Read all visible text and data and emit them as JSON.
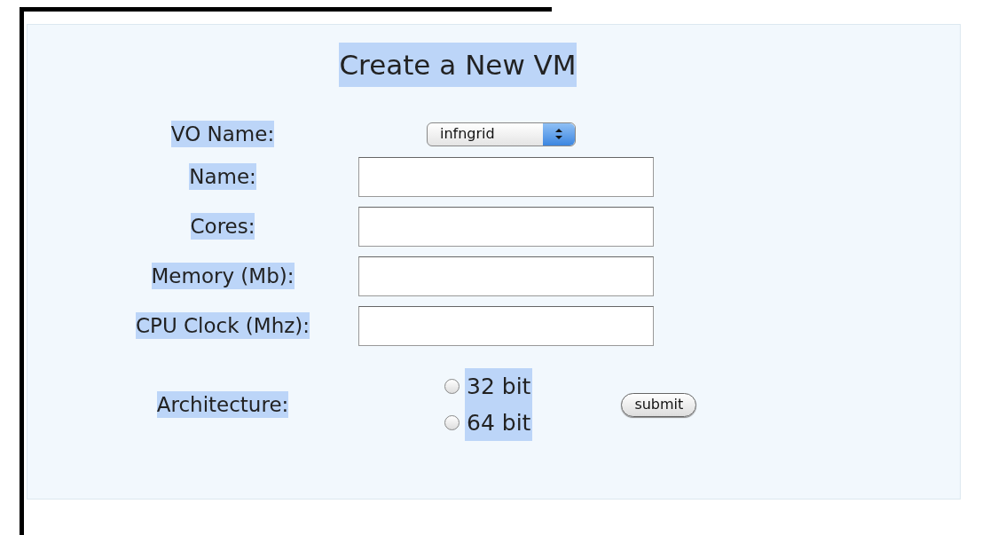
{
  "form": {
    "title": "Create a New VM",
    "fields": [
      {
        "kind": "select",
        "label": "VO Name:",
        "value": "infngrid"
      },
      {
        "kind": "text",
        "label": "Name:"
      },
      {
        "kind": "text",
        "label": "Cores:"
      },
      {
        "kind": "text",
        "label": "Memory (Mb):"
      },
      {
        "kind": "text",
        "label": "CPU Clock (Mhz):"
      },
      {
        "kind": "radio",
        "label": "Architecture:",
        "options": [
          {
            "label": "32 bit",
            "selected": false
          },
          {
            "label": "64 bit",
            "selected": false
          }
        ]
      }
    ],
    "submit": "submit"
  }
}
